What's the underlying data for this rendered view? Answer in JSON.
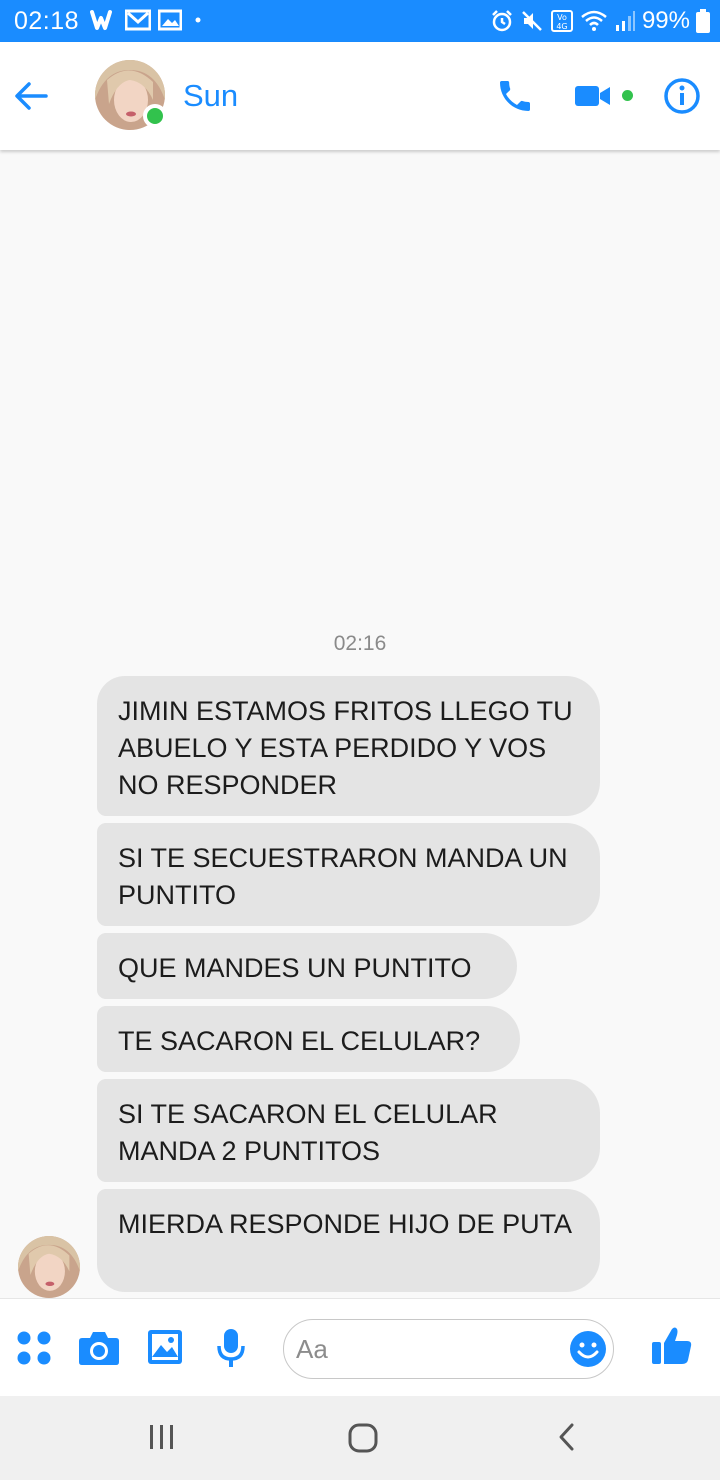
{
  "status_bar": {
    "time": "02:18",
    "battery": "99%"
  },
  "header": {
    "contact_name": "Sun"
  },
  "chat": {
    "timestamp": "02:16",
    "messages": [
      "JIMIN ESTAMOS FRITOS LLEGO TU ABUELO Y ESTA PERDIDO Y VOS NO RESPONDER",
      "SI TE SECUESTRARON MANDA UN PUNTITO",
      "QUE MANDES UN PUNTITO",
      "TE SACARON EL CELULAR?",
      "SI TE SACARON EL CELULAR MANDA 2 PUNTITOS",
      "MIERDA RESPONDE HIJO DE PUTA"
    ]
  },
  "composer": {
    "placeholder": "Aa"
  },
  "colors": {
    "accent": "#1a8cff",
    "online": "#32c24d",
    "bubble": "#e4e4e4"
  },
  "icons": [
    "back-arrow-icon",
    "phone-icon",
    "video-camera-icon",
    "info-icon",
    "apps-grid-icon",
    "camera-icon",
    "image-icon",
    "microphone-icon",
    "emoji-icon",
    "thumbs-up-icon",
    "recent-apps-icon",
    "home-icon",
    "back-nav-icon"
  ]
}
